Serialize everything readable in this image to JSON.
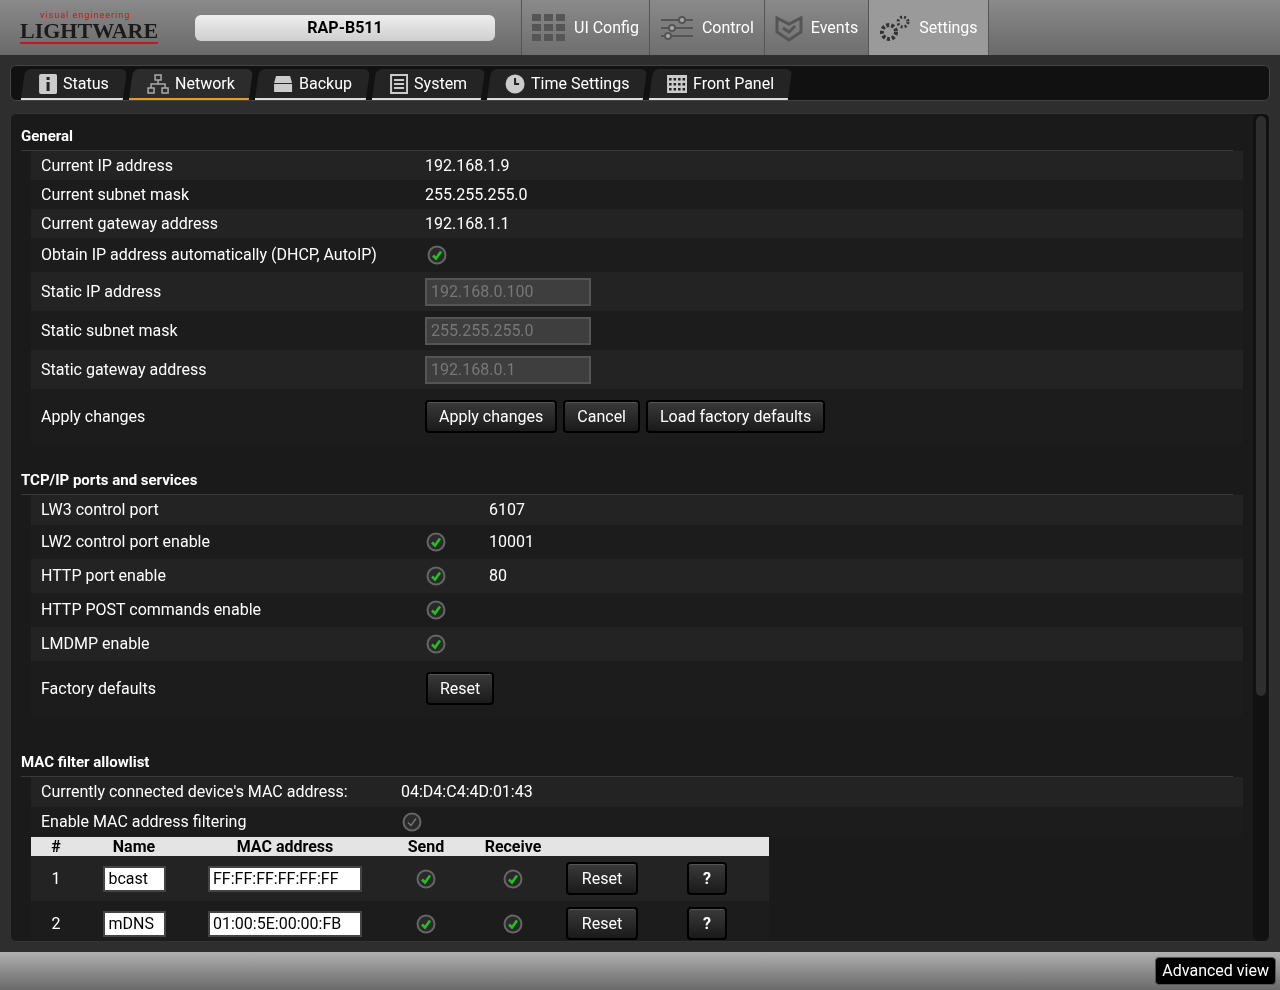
{
  "logo": {
    "tagline": "visual engineering",
    "name": "LIGHTWARE"
  },
  "device_name": "RAP-B511",
  "main_tabs": [
    {
      "label": "UI Config",
      "selected": false
    },
    {
      "label": "Control",
      "selected": false
    },
    {
      "label": "Events",
      "selected": false
    },
    {
      "label": "Settings",
      "selected": true
    }
  ],
  "sub_tabs": [
    {
      "label": "Status",
      "selected": false
    },
    {
      "label": "Network",
      "selected": true
    },
    {
      "label": "Backup",
      "selected": false
    },
    {
      "label": "System",
      "selected": false
    },
    {
      "label": "Time Settings",
      "selected": false
    },
    {
      "label": "Front Panel",
      "selected": false
    }
  ],
  "general": {
    "title": "General",
    "rows": [
      {
        "kind": "text",
        "label": "Current IP address",
        "value": "192.168.1.9"
      },
      {
        "kind": "text",
        "label": "Current subnet mask",
        "value": "255.255.255.0"
      },
      {
        "kind": "text",
        "label": "Current gateway address",
        "value": "192.168.1.1"
      },
      {
        "kind": "check",
        "label": "Obtain IP address automatically (DHCP, AutoIP)",
        "checked": true
      },
      {
        "kind": "field",
        "label": "Static IP address",
        "value": "192.168.0.100",
        "disabled": true
      },
      {
        "kind": "field",
        "label": "Static subnet mask",
        "value": "255.255.255.0",
        "disabled": true
      },
      {
        "kind": "field",
        "label": "Static gateway address",
        "value": "192.168.0.1",
        "disabled": true
      },
      {
        "kind": "buttons",
        "label": "Apply changes",
        "buttons": [
          "Apply changes",
          "Cancel",
          "Load factory defaults"
        ]
      }
    ]
  },
  "tcp": {
    "title": "TCP/IP ports and services",
    "rows": [
      {
        "kind": "value",
        "label": "LW3 control port",
        "value": "6107"
      },
      {
        "kind": "check",
        "label": "LW2 control port enable",
        "checked": true,
        "value": "10001"
      },
      {
        "kind": "check",
        "label": "HTTP port enable",
        "checked": true,
        "value": "80"
      },
      {
        "kind": "check",
        "label": "HTTP POST commands enable",
        "checked": true
      },
      {
        "kind": "check",
        "label": "LMDMP enable",
        "checked": true
      },
      {
        "kind": "button",
        "label": "Factory defaults",
        "button": "Reset"
      }
    ]
  },
  "mac": {
    "title": "MAC filter allowlist",
    "connected_label": "Currently connected device's MAC address:",
    "connected_value": "04:D4:C4:4D:01:43",
    "enable_label": "Enable MAC address filtering",
    "enable_checked": false,
    "columns": [
      "#",
      "Name",
      "MAC address",
      "Send",
      "Receive"
    ],
    "rows": [
      {
        "index": "1",
        "name": "bcast",
        "mac": "FF:FF:FF:FF:FF:FF",
        "send": true,
        "receive": true,
        "reset": "Reset",
        "help": "?"
      },
      {
        "index": "2",
        "name": "mDNS",
        "mac": "01:00:5E:00:00:FB",
        "send": true,
        "receive": true,
        "reset": "Reset",
        "help": "?"
      }
    ]
  },
  "advanced_button": "Advanced view"
}
